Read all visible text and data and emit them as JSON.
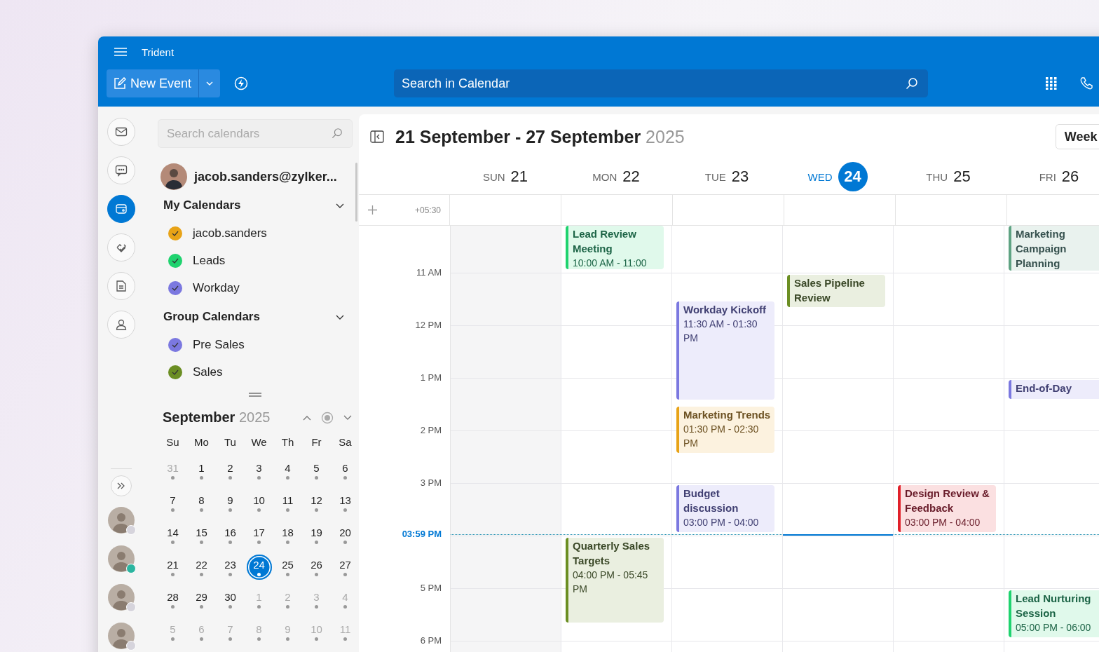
{
  "app": {
    "title": "Trident"
  },
  "toolbar": {
    "new_event": "New Event",
    "search": {
      "placeholder": "Search in Calendar"
    }
  },
  "rail": [
    {
      "kind": "mail",
      "selected": false
    },
    {
      "kind": "chat",
      "selected": false
    },
    {
      "kind": "calendar",
      "selected": true
    },
    {
      "kind": "tasks",
      "selected": false
    },
    {
      "kind": "notes",
      "selected": false
    },
    {
      "kind": "contacts",
      "selected": false
    }
  ],
  "people": [
    {
      "color": "#d6d4dc"
    },
    {
      "color": "#2bb5a0"
    },
    {
      "color": "#d6d4dc"
    },
    {
      "color": "#d6d4dc"
    }
  ],
  "sidebar": {
    "search": {
      "placeholder": "Search calendars"
    },
    "account": "jacob.sanders@zylker...",
    "groups": [
      {
        "title": "My Calendars",
        "expanded": true,
        "items": [
          {
            "label": "jacob.sanders",
            "color": "#e8a317",
            "checked": true
          },
          {
            "label": "Leads",
            "color": "#1fd36f",
            "checked": true
          },
          {
            "label": "Workday",
            "color": "#7b78e0",
            "checked": true
          }
        ]
      },
      {
        "title": "Group Calendars",
        "expanded": true,
        "items": [
          {
            "label": "Pre Sales",
            "color": "#7b78e0",
            "checked": true
          },
          {
            "label": "Sales",
            "color": "#6b8e23",
            "checked": true
          }
        ]
      }
    ],
    "mini_calendar": {
      "month": "September",
      "year": "2025",
      "weekdays": [
        "Su",
        "Mo",
        "Tu",
        "We",
        "Th",
        "Fr",
        "Sa"
      ],
      "weeks": [
        [
          {
            "day": "31",
            "outside": true,
            "selected": false
          },
          {
            "day": "1",
            "outside": false,
            "selected": false
          },
          {
            "day": "2",
            "outside": false,
            "selected": false
          },
          {
            "day": "3",
            "outside": false,
            "selected": false
          },
          {
            "day": "4",
            "outside": false,
            "selected": false
          },
          {
            "day": "5",
            "outside": false,
            "selected": false
          },
          {
            "day": "6",
            "outside": false,
            "selected": false
          }
        ],
        [
          {
            "day": "7",
            "outside": false,
            "selected": false
          },
          {
            "day": "8",
            "outside": false,
            "selected": false
          },
          {
            "day": "9",
            "outside": false,
            "selected": false
          },
          {
            "day": "10",
            "outside": false,
            "selected": false
          },
          {
            "day": "11",
            "outside": false,
            "selected": false
          },
          {
            "day": "12",
            "outside": false,
            "selected": false
          },
          {
            "day": "13",
            "outside": false,
            "selected": false
          }
        ],
        [
          {
            "day": "14",
            "outside": false,
            "selected": false
          },
          {
            "day": "15",
            "outside": false,
            "selected": false
          },
          {
            "day": "16",
            "outside": false,
            "selected": false
          },
          {
            "day": "17",
            "outside": false,
            "selected": false
          },
          {
            "day": "18",
            "outside": false,
            "selected": false
          },
          {
            "day": "19",
            "outside": false,
            "selected": false
          },
          {
            "day": "20",
            "outside": false,
            "selected": false
          }
        ],
        [
          {
            "day": "21",
            "outside": false,
            "selected": false
          },
          {
            "day": "22",
            "outside": false,
            "selected": false
          },
          {
            "day": "23",
            "outside": false,
            "selected": false
          },
          {
            "day": "24",
            "outside": false,
            "selected": true
          },
          {
            "day": "25",
            "outside": false,
            "selected": false
          },
          {
            "day": "26",
            "outside": false,
            "selected": false
          },
          {
            "day": "27",
            "outside": false,
            "selected": false
          }
        ],
        [
          {
            "day": "28",
            "outside": false,
            "selected": false
          },
          {
            "day": "29",
            "outside": false,
            "selected": false
          },
          {
            "day": "30",
            "outside": false,
            "selected": false
          },
          {
            "day": "1",
            "outside": true,
            "selected": false
          },
          {
            "day": "2",
            "outside": true,
            "selected": false
          },
          {
            "day": "3",
            "outside": true,
            "selected": false
          },
          {
            "day": "4",
            "outside": true,
            "selected": false
          }
        ],
        [
          {
            "day": "5",
            "outside": true,
            "selected": false
          },
          {
            "day": "6",
            "outside": true,
            "selected": false
          },
          {
            "day": "7",
            "outside": true,
            "selected": false
          },
          {
            "day": "8",
            "outside": true,
            "selected": false
          },
          {
            "day": "9",
            "outside": true,
            "selected": false
          },
          {
            "day": "10",
            "outside": true,
            "selected": false
          },
          {
            "day": "11",
            "outside": true,
            "selected": false
          }
        ]
      ]
    }
  },
  "calendar": {
    "title": "21 September - 27 September",
    "year": "2025",
    "view": "Week",
    "timezone": "+05:30",
    "hours": [
      "11 AM",
      "12 PM",
      "1 PM",
      "2 PM",
      "3 PM",
      "5 PM",
      "6 PM"
    ],
    "now": "03:59 PM",
    "days": [
      {
        "weekday": "SUN",
        "date": "21",
        "selected": false,
        "nonworking": true
      },
      {
        "weekday": "MON",
        "date": "22",
        "selected": false,
        "nonworking": false,
        "events": [
          {
            "title": "Lead Review Meeting",
            "time": "10:00 AM - 11:00",
            "color": "#1fd36f"
          },
          {
            "title": "Quarterly Sales Targets",
            "time": "04:00 PM - 05:45 PM",
            "color": "#6b8e23"
          }
        ]
      },
      {
        "weekday": "TUE",
        "date": "23",
        "selected": false,
        "nonworking": false,
        "events": [
          {
            "title": "Workday Kickoff",
            "time": "11:30 AM - 01:30 PM",
            "color": "#7b78e0"
          },
          {
            "title": "Marketing Trends",
            "time": "01:30 PM - 02:30 PM",
            "color": "#e8a317"
          },
          {
            "title": "Budget discussion",
            "time": "03:00 PM - 04:00",
            "color": "#7b78e0"
          }
        ]
      },
      {
        "weekday": "WED",
        "date": "24",
        "selected": true,
        "nonworking": false,
        "events": [
          {
            "title": "Sales Pipeline Review",
            "color": "#6b8e23"
          }
        ]
      },
      {
        "weekday": "THU",
        "date": "25",
        "selected": false,
        "nonworking": false,
        "events": [
          {
            "title": "Design Review & Feedback",
            "time": "03:00 PM - 04:00",
            "color": "#e0202a"
          }
        ]
      },
      {
        "weekday": "FRI",
        "date": "26",
        "selected": false,
        "nonworking": false,
        "events": [
          {
            "title": "Marketing Campaign Planning",
            "color": "#5fa383"
          },
          {
            "title": "End-of-Day",
            "color": "#7b78e0"
          },
          {
            "title": "Lead Nurturing Session",
            "time": "05:00 PM - 06:00",
            "color": "#1fd36f"
          }
        ]
      }
    ]
  }
}
